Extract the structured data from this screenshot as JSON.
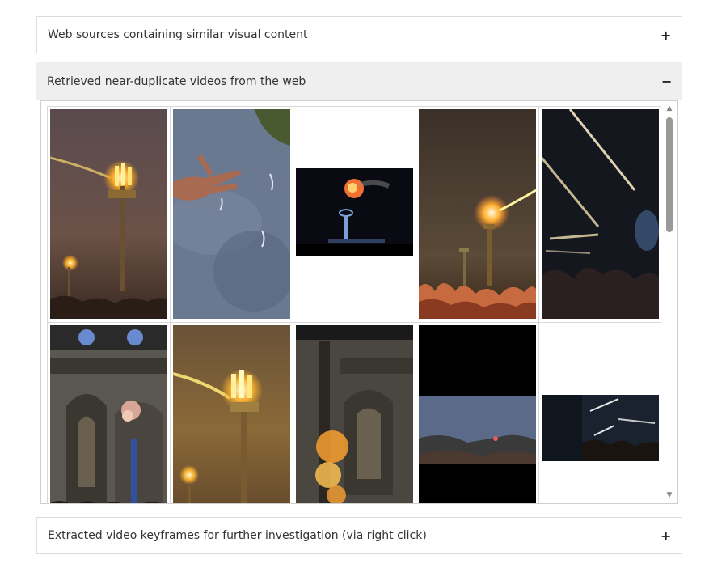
{
  "panels": {
    "web_sources": {
      "title": "Web sources containing similar visual content",
      "toggle": "+"
    },
    "near_duplicates": {
      "title": "Retrieved near-duplicate videos from the web",
      "toggle": "−"
    },
    "keyframes": {
      "title": "Extracted video keyframes for further investigation (via right click)",
      "toggle": "+"
    }
  },
  "scrollbar": {
    "up": "▲",
    "down": "▼"
  },
  "thumbnails": [
    {
      "name": "video-thumb-torch-tower",
      "desc": "torch tower with flames"
    },
    {
      "name": "video-thumb-hand-sky",
      "desc": "hand against night sky"
    },
    {
      "name": "video-thumb-fireball-tower",
      "desc": "fireball above tower"
    },
    {
      "name": "video-thumb-crowd-flame",
      "desc": "crowd with flame tower"
    },
    {
      "name": "video-thumb-streaks",
      "desc": "light streaks over crowd"
    },
    {
      "name": "video-thumb-cathedral",
      "desc": "cathedral interior smoke"
    },
    {
      "name": "video-thumb-torch-closeup",
      "desc": "torch closeup"
    },
    {
      "name": "video-thumb-cathedral-fire",
      "desc": "cathedral interior fire"
    },
    {
      "name": "video-thumb-crowd-sky",
      "desc": "crowd under blue sky"
    },
    {
      "name": "video-thumb-crowd-night",
      "desc": "crowd at night"
    }
  ]
}
